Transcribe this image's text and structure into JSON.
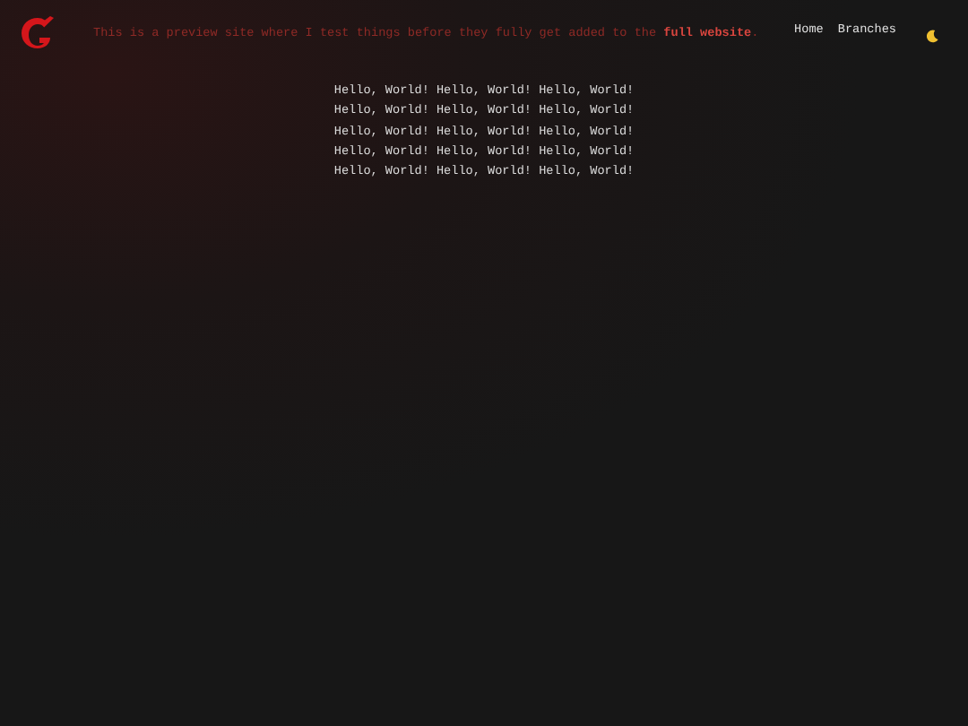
{
  "banner": {
    "text": "This is a preview site where I test things before they fully get added to the ",
    "link": "full website",
    "end": "."
  },
  "nav": [
    {
      "label": "Home"
    },
    {
      "label": "Branches"
    }
  ],
  "lines": [
    "Hello, World! Hello, World! Hello, World!",
    "Hello, World! Hello, World! Hello, World!",
    "Hello, World! Hello, World! Hello, World!",
    "Hello, World! Hello, World! Hello, World!",
    "Hello, World! Hello, World! Hello, World!"
  ]
}
